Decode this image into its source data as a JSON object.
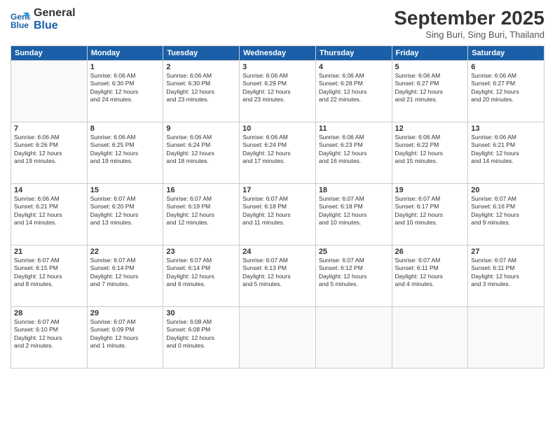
{
  "header": {
    "logo_line1": "General",
    "logo_line2": "Blue",
    "month": "September 2025",
    "location": "Sing Buri, Sing Buri, Thailand"
  },
  "days_of_week": [
    "Sunday",
    "Monday",
    "Tuesday",
    "Wednesday",
    "Thursday",
    "Friday",
    "Saturday"
  ],
  "weeks": [
    [
      {
        "num": "",
        "info": ""
      },
      {
        "num": "1",
        "info": "Sunrise: 6:06 AM\nSunset: 6:30 PM\nDaylight: 12 hours\nand 24 minutes."
      },
      {
        "num": "2",
        "info": "Sunrise: 6:06 AM\nSunset: 6:30 PM\nDaylight: 12 hours\nand 23 minutes."
      },
      {
        "num": "3",
        "info": "Sunrise: 6:06 AM\nSunset: 6:29 PM\nDaylight: 12 hours\nand 23 minutes."
      },
      {
        "num": "4",
        "info": "Sunrise: 6:06 AM\nSunset: 6:28 PM\nDaylight: 12 hours\nand 22 minutes."
      },
      {
        "num": "5",
        "info": "Sunrise: 6:06 AM\nSunset: 6:27 PM\nDaylight: 12 hours\nand 21 minutes."
      },
      {
        "num": "6",
        "info": "Sunrise: 6:06 AM\nSunset: 6:27 PM\nDaylight: 12 hours\nand 20 minutes."
      }
    ],
    [
      {
        "num": "7",
        "info": "Sunrise: 6:06 AM\nSunset: 6:26 PM\nDaylight: 12 hours\nand 19 minutes."
      },
      {
        "num": "8",
        "info": "Sunrise: 6:06 AM\nSunset: 6:25 PM\nDaylight: 12 hours\nand 19 minutes."
      },
      {
        "num": "9",
        "info": "Sunrise: 6:06 AM\nSunset: 6:24 PM\nDaylight: 12 hours\nand 18 minutes."
      },
      {
        "num": "10",
        "info": "Sunrise: 6:06 AM\nSunset: 6:24 PM\nDaylight: 12 hours\nand 17 minutes."
      },
      {
        "num": "11",
        "info": "Sunrise: 6:06 AM\nSunset: 6:23 PM\nDaylight: 12 hours\nand 16 minutes."
      },
      {
        "num": "12",
        "info": "Sunrise: 6:06 AM\nSunset: 6:22 PM\nDaylight: 12 hours\nand 15 minutes."
      },
      {
        "num": "13",
        "info": "Sunrise: 6:06 AM\nSunset: 6:21 PM\nDaylight: 12 hours\nand 14 minutes."
      }
    ],
    [
      {
        "num": "14",
        "info": "Sunrise: 6:06 AM\nSunset: 6:21 PM\nDaylight: 12 hours\nand 14 minutes."
      },
      {
        "num": "15",
        "info": "Sunrise: 6:07 AM\nSunset: 6:20 PM\nDaylight: 12 hours\nand 13 minutes."
      },
      {
        "num": "16",
        "info": "Sunrise: 6:07 AM\nSunset: 6:19 PM\nDaylight: 12 hours\nand 12 minutes."
      },
      {
        "num": "17",
        "info": "Sunrise: 6:07 AM\nSunset: 6:18 PM\nDaylight: 12 hours\nand 11 minutes."
      },
      {
        "num": "18",
        "info": "Sunrise: 6:07 AM\nSunset: 6:18 PM\nDaylight: 12 hours\nand 10 minutes."
      },
      {
        "num": "19",
        "info": "Sunrise: 6:07 AM\nSunset: 6:17 PM\nDaylight: 12 hours\nand 10 minutes."
      },
      {
        "num": "20",
        "info": "Sunrise: 6:07 AM\nSunset: 6:16 PM\nDaylight: 12 hours\nand 9 minutes."
      }
    ],
    [
      {
        "num": "21",
        "info": "Sunrise: 6:07 AM\nSunset: 6:15 PM\nDaylight: 12 hours\nand 8 minutes."
      },
      {
        "num": "22",
        "info": "Sunrise: 6:07 AM\nSunset: 6:14 PM\nDaylight: 12 hours\nand 7 minutes."
      },
      {
        "num": "23",
        "info": "Sunrise: 6:07 AM\nSunset: 6:14 PM\nDaylight: 12 hours\nand 6 minutes."
      },
      {
        "num": "24",
        "info": "Sunrise: 6:07 AM\nSunset: 6:13 PM\nDaylight: 12 hours\nand 5 minutes."
      },
      {
        "num": "25",
        "info": "Sunrise: 6:07 AM\nSunset: 6:12 PM\nDaylight: 12 hours\nand 5 minutes."
      },
      {
        "num": "26",
        "info": "Sunrise: 6:07 AM\nSunset: 6:11 PM\nDaylight: 12 hours\nand 4 minutes."
      },
      {
        "num": "27",
        "info": "Sunrise: 6:07 AM\nSunset: 6:11 PM\nDaylight: 12 hours\nand 3 minutes."
      }
    ],
    [
      {
        "num": "28",
        "info": "Sunrise: 6:07 AM\nSunset: 6:10 PM\nDaylight: 12 hours\nand 2 minutes."
      },
      {
        "num": "29",
        "info": "Sunrise: 6:07 AM\nSunset: 6:09 PM\nDaylight: 12 hours\nand 1 minute."
      },
      {
        "num": "30",
        "info": "Sunrise: 6:08 AM\nSunset: 6:08 PM\nDaylight: 12 hours\nand 0 minutes."
      },
      {
        "num": "",
        "info": ""
      },
      {
        "num": "",
        "info": ""
      },
      {
        "num": "",
        "info": ""
      },
      {
        "num": "",
        "info": ""
      }
    ]
  ]
}
